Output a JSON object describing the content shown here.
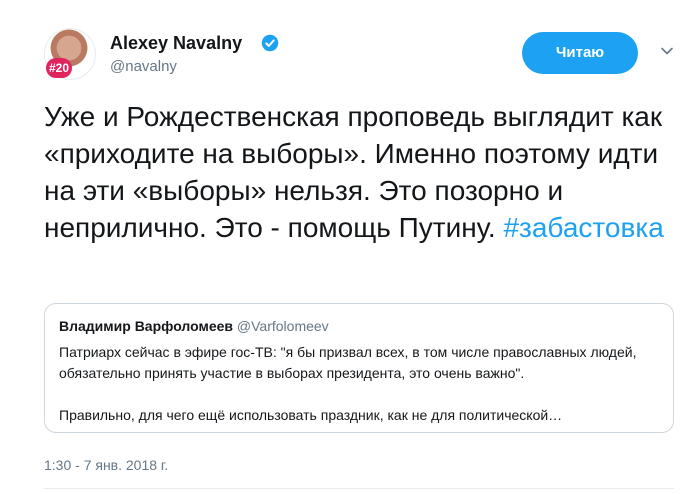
{
  "author": {
    "name": "Alexey Navalny",
    "handle": "@navalny",
    "avatar_badge": "#20"
  },
  "follow_button": {
    "label": "Читаю"
  },
  "tweet": {
    "text": "Уже и Рождественская проповедь выглядит как «приходите на выборы». Именно поэтому идти на эти «выборы» нельзя. Это позорно и неприлично. Это - помощь Путину.",
    "hashtag": "#забастовка"
  },
  "quoted_tweet": {
    "name": "Владимир Варфоломеев",
    "handle": "@Varfolomeev",
    "line1": "Патриарх сейчас в эфире гос-ТВ: \"я бы призвал всех, в том числе православных людей, обязательно принять участие в выборах президента, это очень важно\".",
    "line2": "Правильно, для чего ещё использовать праздник, как не для политической…"
  },
  "timestamp": "1:30 - 7 янв. 2018 г.",
  "colors": {
    "accent": "#1da1f2",
    "text": "#14171a",
    "muted": "#657786",
    "border": "#cdd7dd"
  },
  "icons": [
    "verified-badge-icon",
    "chevron-down-icon"
  ]
}
